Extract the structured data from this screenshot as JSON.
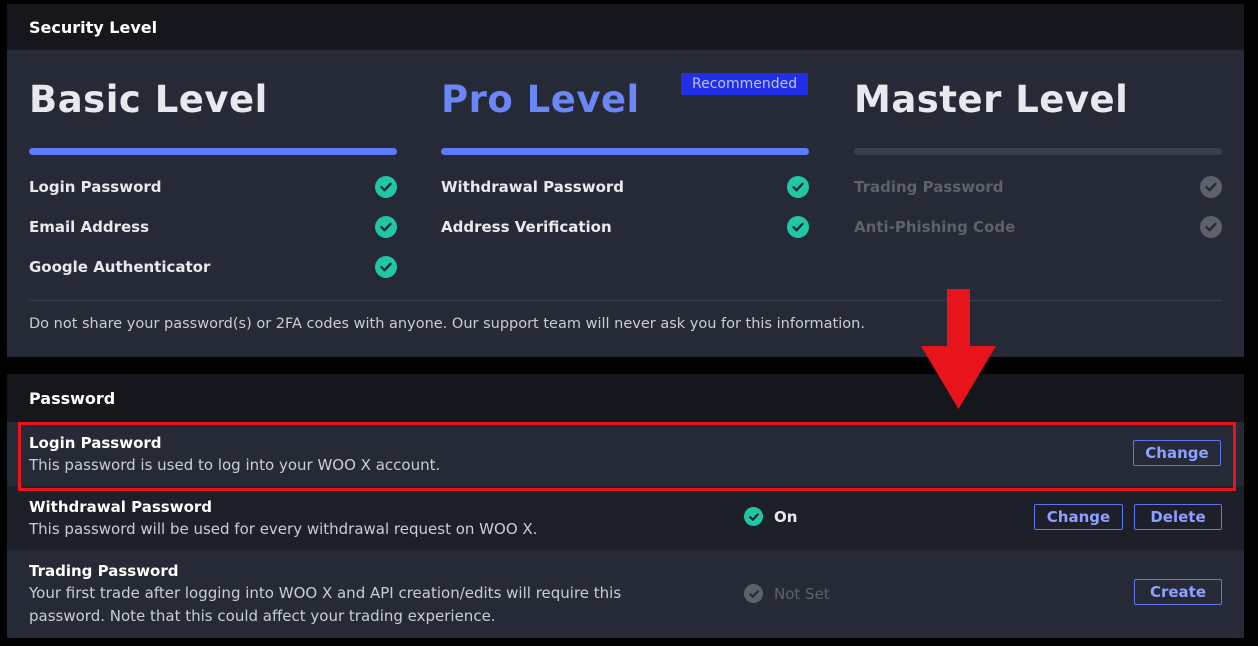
{
  "colors": {
    "accent": "#5c7cfa",
    "check_green": "#1fc7a5",
    "check_gray": "#5d616b",
    "badge_bg": "#2130e6",
    "highlight_red": "#e8141c"
  },
  "security": {
    "header": "Security Level",
    "levels": [
      {
        "title": "Basic Level",
        "items": [
          {
            "label": "Login Password",
            "icon": "check-circle-icon",
            "status": "done"
          },
          {
            "label": "Email Address",
            "icon": "check-circle-icon",
            "status": "done"
          },
          {
            "label": "Google Authenticator",
            "icon": "check-circle-icon",
            "status": "done"
          }
        ]
      },
      {
        "title": "Pro Level",
        "badge": "Recommended",
        "items": [
          {
            "label": "Withdrawal Password",
            "icon": "check-circle-icon",
            "status": "done"
          },
          {
            "label": "Address Verification",
            "icon": "check-circle-icon",
            "status": "done"
          }
        ]
      },
      {
        "title": "Master Level",
        "items": [
          {
            "label": "Trading Password",
            "icon": "check-circle-icon",
            "status": "pending"
          },
          {
            "label": "Anti-Phishing Code",
            "icon": "check-circle-icon",
            "status": "pending"
          }
        ]
      }
    ],
    "notice": "Do not share your password(s) or 2FA codes with anyone. Our support team will never ask you for this information."
  },
  "password": {
    "header": "Password",
    "rows": [
      {
        "title": "Login Password",
        "description": "This password is used to log into your WOO X account.",
        "buttons": [
          "Change"
        ]
      },
      {
        "title": "Withdrawal Password",
        "description": "This password will be used for every withdrawal request on WOO X.",
        "status": "On",
        "buttons": [
          "Change",
          "Delete"
        ]
      },
      {
        "title": "Trading Password",
        "description": "Your first trade after logging into WOO X and API creation/edits will require this password. Note that this could affect your trading experience.",
        "status": "Not Set",
        "buttons": [
          "Create"
        ]
      }
    ]
  },
  "annotation": {
    "arrow_icon": "down-arrow-icon",
    "highlight": "login-password-row"
  }
}
